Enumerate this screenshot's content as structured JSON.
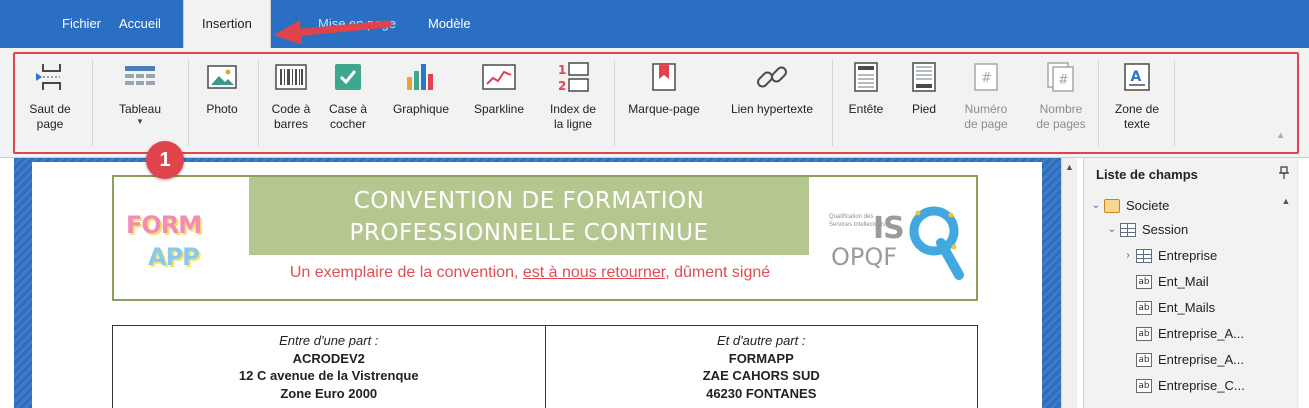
{
  "menu": {
    "tabs": [
      {
        "label": "Fichier"
      },
      {
        "label": "Accueil"
      },
      {
        "label": "Insertion"
      },
      {
        "label": "Mise en page"
      },
      {
        "label": "Modèle"
      }
    ],
    "active": "Insertion"
  },
  "ribbon": {
    "buttons": [
      {
        "label": "Saut de\npage",
        "icon": "page-break-icon"
      },
      {
        "label": "Tableau",
        "icon": "table-icon",
        "has_dropdown": true
      },
      {
        "label": "Photo",
        "icon": "picture-icon"
      },
      {
        "label": "Code à\nbarres",
        "icon": "barcode-icon"
      },
      {
        "label": "Case à\ncocher",
        "icon": "checkbox-icon"
      },
      {
        "label": "Graphique",
        "icon": "bar-chart-icon"
      },
      {
        "label": "Sparkline",
        "icon": "sparkline-icon"
      },
      {
        "label": "Index de\nla ligne",
        "icon": "row-index-icon"
      },
      {
        "label": "Marque-page",
        "icon": "bookmark-icon"
      },
      {
        "label": "Lien hypertexte",
        "icon": "hyperlink-icon"
      },
      {
        "label": "Entête",
        "icon": "header-icon"
      },
      {
        "label": "Pied",
        "icon": "footer-icon"
      },
      {
        "label": "Numéro\nde page",
        "icon": "page-number-icon",
        "disabled": true
      },
      {
        "label": "Nombre\nde pages",
        "icon": "page-count-icon",
        "disabled": true
      },
      {
        "label": "Zone de\ntexte",
        "icon": "text-box-icon"
      }
    ]
  },
  "annotations": {
    "badge_number": "1",
    "accent_color": "#e0434b"
  },
  "document": {
    "title_line1": "CONVENTION DE FORMATION",
    "title_line2": "PROFESSIONNELLE CONTINUE",
    "subtitle_part1": "Un exemplaire de la convention, ",
    "subtitle_underlined": "est à nous retourner",
    "subtitle_part2": ", dûment signé",
    "logo_left": {
      "word1": "FORM",
      "word2": "APP"
    },
    "logo_right": {
      "small_text": "Qualification des Services Intellectuels",
      "mark": "IS",
      "letter": "Q",
      "name": "OPQF"
    },
    "left_party": {
      "intro": "Entre d'une part :",
      "name": "ACRODEV2",
      "address1": "12 C avenue de la Vistrenque",
      "address2": "Zone Euro 2000"
    },
    "right_party": {
      "intro": "Et d'autre part :",
      "name": "FORMAPP",
      "address1": "ZAE CAHORS SUD",
      "address2": "46230 FONTANES"
    }
  },
  "field_list": {
    "title": "Liste de champs",
    "items": [
      {
        "label": "Societe",
        "type": "database",
        "level": 0,
        "expand": "expanded"
      },
      {
        "label": "Session",
        "type": "table",
        "level": 1,
        "expand": "expanded"
      },
      {
        "label": "Entreprise",
        "type": "table",
        "level": 2,
        "expand": "collapsed"
      },
      {
        "label": "Ent_Mail",
        "type": "field",
        "level": 2
      },
      {
        "label": "Ent_Mails",
        "type": "field",
        "level": 2
      },
      {
        "label": "Entreprise_A...",
        "type": "field",
        "level": 2
      },
      {
        "label": "Entreprise_A...",
        "type": "field",
        "level": 2
      },
      {
        "label": "Entreprise_C...",
        "type": "field",
        "level": 2
      }
    ]
  },
  "colors": {
    "menubar": "#2b6fc2",
    "ribbon_bg": "#f2f2f2",
    "banner_border": "#8aa15b",
    "title_block": "#b3c78f",
    "subtitle": "#e24d55",
    "workspace": "#2f6dbc"
  }
}
